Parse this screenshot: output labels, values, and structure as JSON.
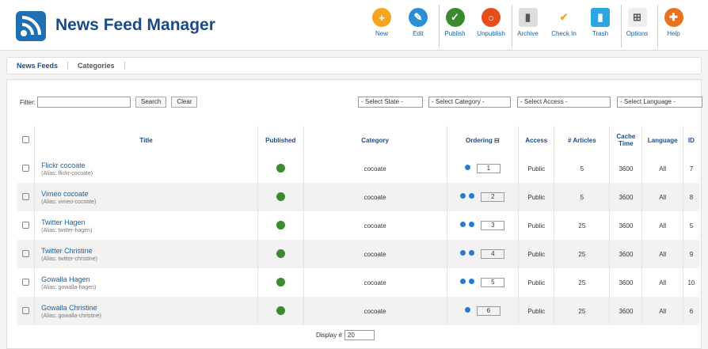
{
  "app": {
    "title": "News Feed Manager"
  },
  "toolbar": {
    "new": "New",
    "edit": "Edit",
    "publish": "Publish",
    "unpublish": "Unpublish",
    "archive": "Archive",
    "checkin": "Check In",
    "trash": "Trash",
    "options": "Options",
    "help": "Help"
  },
  "subnav": {
    "feeds": "News Feeds",
    "categories": "Categories"
  },
  "filter": {
    "label": "Filter:",
    "value": "",
    "search": "Search",
    "clear": "Clear",
    "state": "- Select State -",
    "category": "- Select Category -",
    "access": "- Select Access -",
    "language": "- Select Language -"
  },
  "table": {
    "headers": {
      "title": "Title",
      "published": "Published",
      "category": "Category",
      "ordering": "Ordering",
      "access": "Access",
      "articles": "# Articles",
      "cache": "Cache Time",
      "language": "Language",
      "id": "ID"
    },
    "rows": [
      {
        "title": "Flickr cocoate",
        "alias": "(Alias: flickr-cocoate)",
        "category": "cocoate",
        "order": "1",
        "access": "Public",
        "articles": "5",
        "cache": "3600",
        "language": "All",
        "id": "7"
      },
      {
        "title": "Vimeo cocoate",
        "alias": "(Alias: vimeo-cocoate)",
        "category": "cocoate",
        "order": "2",
        "access": "Public",
        "articles": "5",
        "cache": "3600",
        "language": "All",
        "id": "8"
      },
      {
        "title": "Twitter Hagen",
        "alias": "(Alias: twitter-hagen)",
        "category": "cocoate",
        "order": "3",
        "access": "Public",
        "articles": "25",
        "cache": "3600",
        "language": "All",
        "id": "5"
      },
      {
        "title": "Twitter Christine",
        "alias": "(Alias: twitter-christine)",
        "category": "cocoate",
        "order": "4",
        "access": "Public",
        "articles": "25",
        "cache": "3600",
        "language": "All",
        "id": "9"
      },
      {
        "title": "Gowalla Hagen",
        "alias": "(Alias: gowalla-hagen)",
        "category": "cocoate",
        "order": "5",
        "access": "Public",
        "articles": "25",
        "cache": "3600",
        "language": "All",
        "id": "10"
      },
      {
        "title": "Gowalla Christine",
        "alias": "(Alias: gowalla-christine)",
        "category": "cocoate",
        "order": "6",
        "access": "Public",
        "articles": "25",
        "cache": "3600",
        "language": "All",
        "id": "6"
      }
    ]
  },
  "pagination": {
    "label": "Display #",
    "value": "20"
  }
}
